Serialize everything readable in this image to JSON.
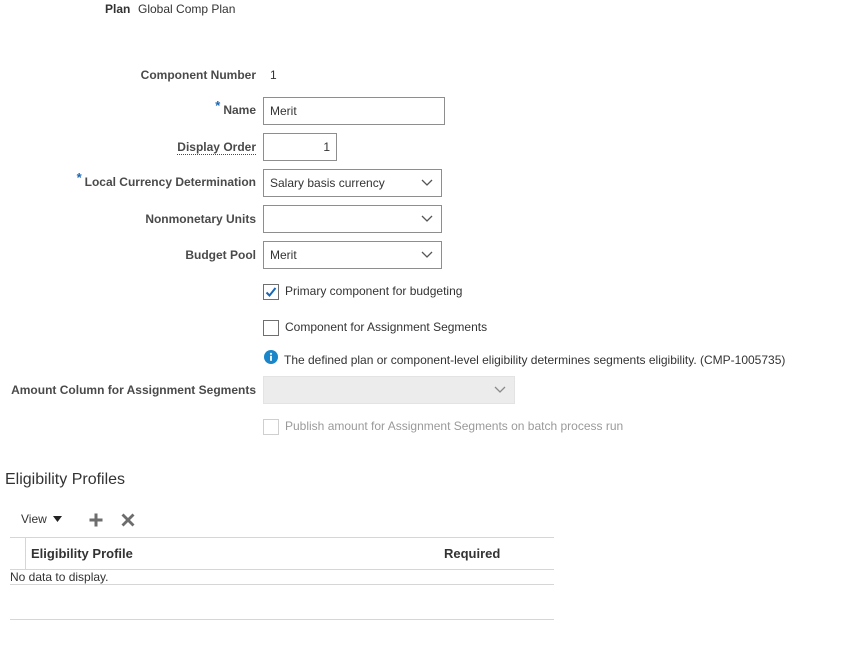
{
  "plan": {
    "label": "Plan",
    "value": "Global Comp Plan"
  },
  "component_number": {
    "label": "Component Number",
    "value": "1"
  },
  "name": {
    "label": "Name",
    "required_marker": "*",
    "value": "Merit"
  },
  "display_order": {
    "label": "Display Order",
    "value": "1"
  },
  "local_currency": {
    "label": "Local Currency Determination",
    "required_marker": "*",
    "value": "Salary basis currency"
  },
  "nonmonetary_units": {
    "label": "Nonmonetary Units",
    "value": ""
  },
  "budget_pool": {
    "label": "Budget Pool",
    "value": "Merit"
  },
  "primary_component": {
    "label": "Primary component for budgeting",
    "checked": true
  },
  "assignment_segments": {
    "label": "Component for Assignment Segments",
    "checked": false
  },
  "info_message": "The defined plan or component-level eligibility determines segments eligibility. (CMP-1005735)",
  "amount_column": {
    "label": "Amount Column for Assignment Segments",
    "value": "",
    "disabled": true
  },
  "publish_amount": {
    "label": "Publish amount for Assignment Segments on batch process run",
    "checked": false,
    "disabled": true
  },
  "eligibility_profiles": {
    "title": "Eligibility Profiles",
    "toolbar": {
      "view_label": "View"
    },
    "columns": [
      "Eligibility Profile",
      "Required"
    ],
    "empty_text": "No data to display."
  },
  "colors": {
    "accent": "#1a66b3",
    "info": "#1b85c9",
    "border": "#8e8e8e"
  },
  "icons": {
    "chevron": "chevron-down-icon",
    "check": "checkmark-icon",
    "info": "info-icon",
    "add": "add-icon",
    "delete": "delete-icon",
    "view_caret": "caret-down-icon"
  }
}
